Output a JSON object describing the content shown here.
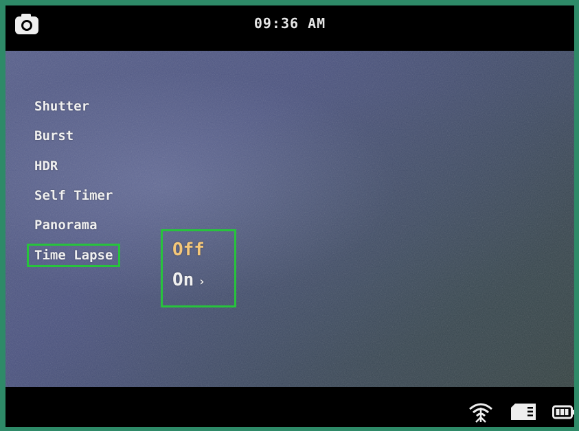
{
  "status_bar": {
    "time": "09:36 AM",
    "camera_icon": "camera-icon",
    "bottom_icons": [
      "wifi-icon",
      "sd-card-icon",
      "battery-icon"
    ]
  },
  "menu": {
    "items": [
      {
        "label": "Shutter"
      },
      {
        "label": "Burst"
      },
      {
        "label": "HDR"
      },
      {
        "label": "Self Timer"
      },
      {
        "label": "Panorama"
      },
      {
        "label": "Time Lapse",
        "selected": true
      }
    ]
  },
  "submenu": {
    "options": [
      {
        "label": "Off",
        "selected": true
      },
      {
        "label": "On",
        "chevron": "›"
      }
    ]
  },
  "colors": {
    "highlight_border": "#27c33c",
    "selected_option": "#f5c779",
    "text": "#f0f0f0"
  }
}
